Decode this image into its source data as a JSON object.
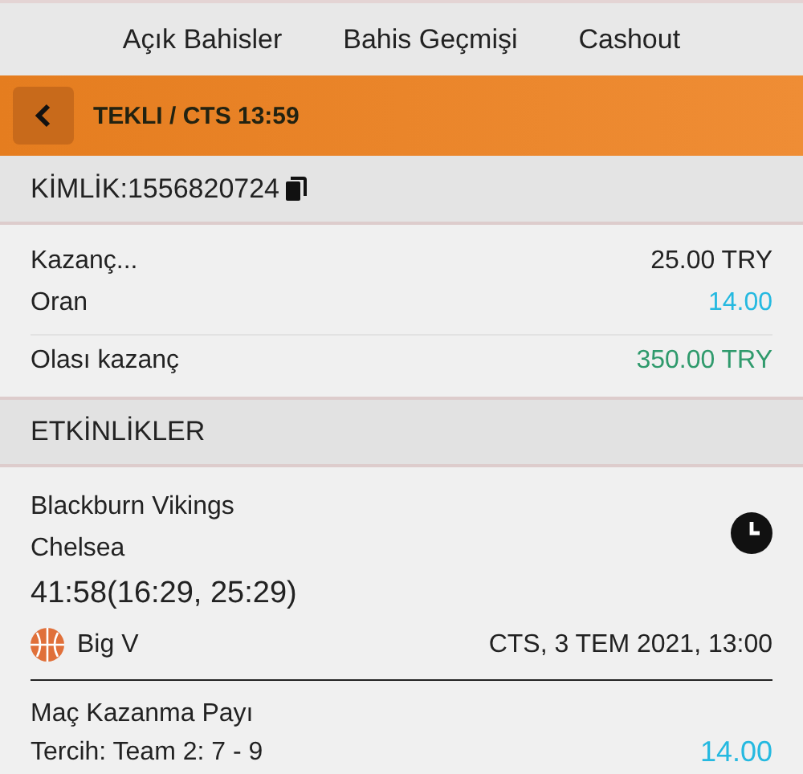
{
  "tabs": [
    "Açık Bahisler",
    "Bahis Geçmişi",
    "Cashout"
  ],
  "header": {
    "title": "TEKLI / CTS 13:59"
  },
  "id_bar": {
    "label": "KİMLİK:1556820724"
  },
  "summary": [
    {
      "kind": "plain",
      "label": "Kazanç...",
      "value": "25.00 TRY"
    },
    {
      "kind": "odds",
      "label": "Oran",
      "value": "14.00"
    },
    {
      "kind": "win",
      "label": "Olası kazanç",
      "value": "350.00 TRY"
    }
  ],
  "events_heading": "ETKİNLİKLER",
  "event": {
    "home": "Blackburn Vikings",
    "away": "Chelsea",
    "score": "41:58(16:29, 25:29)",
    "league": "Big V",
    "date": "CTS, 3 TEM 2021, 13:00",
    "market": "Maç Kazanma Payı",
    "pick": "Tercih: Team 2: 7 - 9",
    "odds": "14.00"
  }
}
